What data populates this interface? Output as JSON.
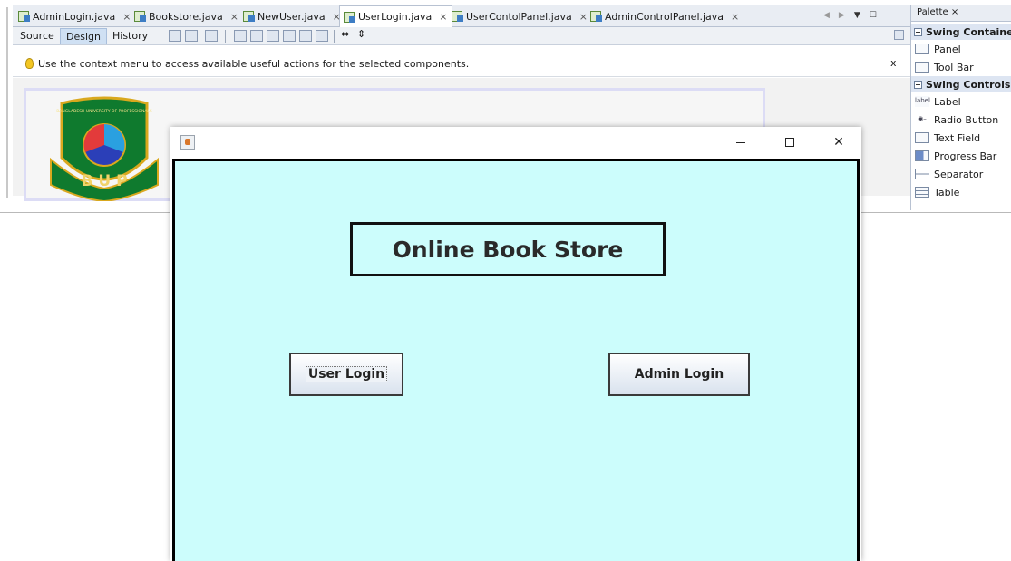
{
  "ide": {
    "tabs": [
      {
        "label": "AdminLogin.java",
        "active": false
      },
      {
        "label": "Bookstore.java",
        "active": false
      },
      {
        "label": "NewUser.java",
        "active": false
      },
      {
        "label": "UserLogin.java",
        "active": true
      },
      {
        "label": "UserContolPanel.java",
        "active": false
      },
      {
        "label": "AdminControlPanel.java",
        "active": false
      }
    ],
    "view_buttons": {
      "source": "Source",
      "design": "Design",
      "history": "History"
    },
    "hint": "Use the context menu to access available useful actions for the selected components.",
    "hint_close": "x",
    "tab_close": "×",
    "logo_text": "BANGLADESH UNIVERSITY OF PROFESSIONALS",
    "logo_letters": "B U P"
  },
  "palette": {
    "title": "Palette ×",
    "categories": [
      {
        "label": "Swing Containe"
      },
      {
        "label": "Swing Controls"
      }
    ],
    "containers": [
      {
        "label": "Panel",
        "icon": "panel-icon"
      },
      {
        "label": "Tool Bar",
        "icon": "toolbar-icon"
      }
    ],
    "controls": [
      {
        "label": "Label",
        "icon": "label-icon",
        "glyph": "label"
      },
      {
        "label": "Radio Button",
        "icon": "radio-button-icon"
      },
      {
        "label": "Text Field",
        "icon": "text-field-icon"
      },
      {
        "label": "Progress Bar",
        "icon": "progress-bar-icon"
      },
      {
        "label": "Separator",
        "icon": "separator-icon"
      },
      {
        "label": "Table",
        "icon": "table-icon"
      }
    ]
  },
  "window": {
    "heading": "Online Book Store",
    "user_login": "User Login",
    "admin_login": "Admin Login",
    "close_glyph": "✕",
    "colors": {
      "background": "#ccfdfc",
      "border": "#000000"
    }
  }
}
